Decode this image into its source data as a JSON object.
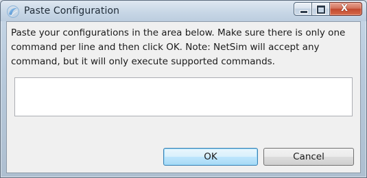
{
  "window": {
    "title": "Paste Configuration",
    "app_icon": "netsim-swirl-icon",
    "caption": {
      "minimize_icon": "minimize-icon",
      "maximize_icon": "maximize-icon",
      "close_icon": "close-icon",
      "close_glyph": "X"
    }
  },
  "dialog": {
    "message": "Paste your configurations in the area below. Make sure there is only one command per line and then click OK. Note: NetSim will accept any command, but it will only execute supported commands.",
    "config_value": "",
    "ok_label": "OK",
    "cancel_label": "Cancel"
  },
  "colors": {
    "accent": "#3c7fb1",
    "close_button": "#c24a30",
    "client_background": "#f0f0f0"
  }
}
